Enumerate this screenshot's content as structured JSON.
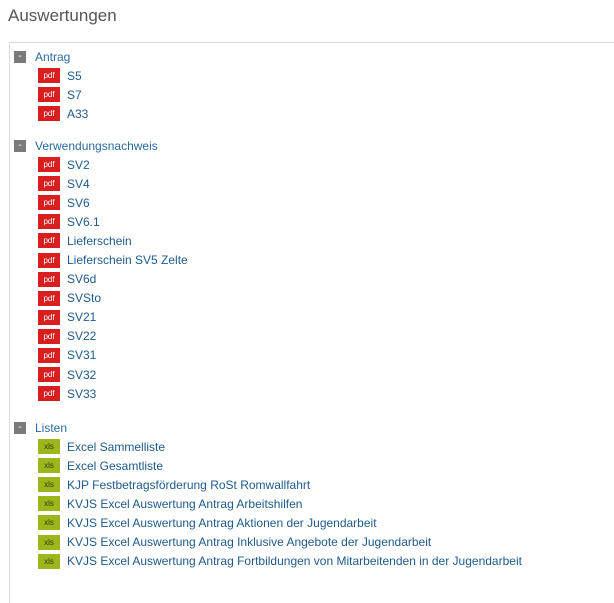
{
  "title": "Auswertungen",
  "toggle_symbol": "-",
  "colors": {
    "pdf_badge": "#d81e1e",
    "xls_badge": "#9cb71c",
    "link": "#1e5a8c"
  },
  "groups": [
    {
      "label": "Antrag",
      "items": [
        {
          "type": "pdf",
          "label": "S5"
        },
        {
          "type": "pdf",
          "label": "S7"
        },
        {
          "type": "pdf",
          "label": "A33"
        }
      ]
    },
    {
      "label": "Verwendungsnachweis",
      "items": [
        {
          "type": "pdf",
          "label": "SV2"
        },
        {
          "type": "pdf",
          "label": "SV4"
        },
        {
          "type": "pdf",
          "label": "SV6"
        },
        {
          "type": "pdf",
          "label": "SV6.1"
        },
        {
          "type": "pdf",
          "label": "Lieferschein"
        },
        {
          "type": "pdf",
          "label": "Lieferschein SV5 Zelte"
        },
        {
          "type": "pdf",
          "label": "SV6d"
        },
        {
          "type": "pdf",
          "label": "SVSto"
        },
        {
          "type": "pdf",
          "label": "SV21"
        },
        {
          "type": "pdf",
          "label": "SV22"
        },
        {
          "type": "pdf",
          "label": "SV31"
        },
        {
          "type": "pdf",
          "label": "SV32"
        },
        {
          "type": "pdf",
          "label": "SV33"
        }
      ]
    },
    {
      "label": "Listen",
      "items": [
        {
          "type": "xls",
          "label": "Excel Sammelliste"
        },
        {
          "type": "xls",
          "label": "Excel Gesamtliste"
        },
        {
          "type": "xls",
          "label": "KJP Festbetragsförderung RoSt Romwallfahrt"
        },
        {
          "type": "xls",
          "label": "KVJS Excel Auswertung Antrag Arbeitshilfen"
        },
        {
          "type": "xls",
          "label": "KVJS Excel Auswertung Antrag Aktionen der Jugendarbeit"
        },
        {
          "type": "xls",
          "label": "KVJS Excel Auswertung Antrag Inklusive Angebote der Jugendarbeit"
        },
        {
          "type": "xls",
          "label": "KVJS Excel Auswertung Antrag Fortbildungen von Mitarbeitenden in der Jugendarbeit"
        }
      ]
    }
  ]
}
